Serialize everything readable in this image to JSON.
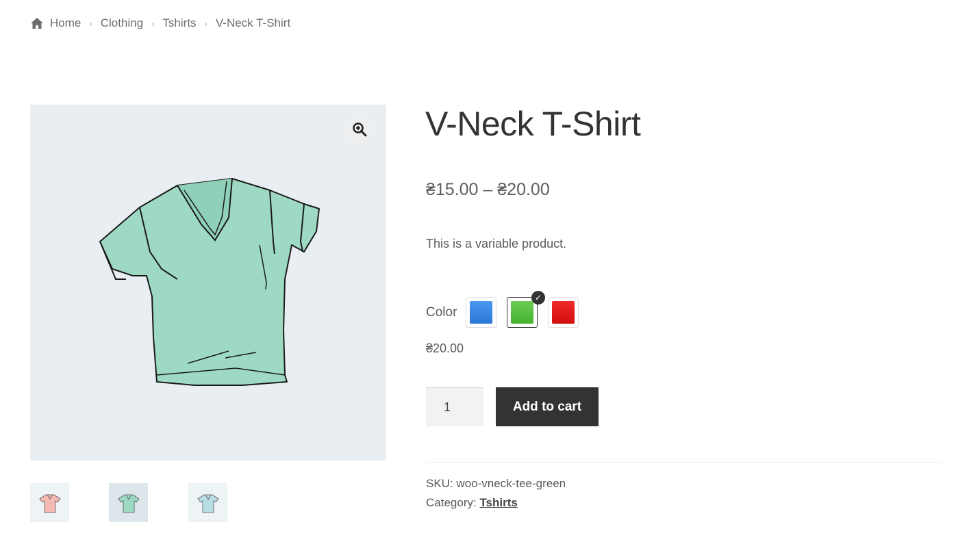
{
  "breadcrumb": {
    "home_icon": "home-icon",
    "items": [
      "Home",
      "Clothing",
      "Tshirts",
      "V-Neck T-Shirt"
    ],
    "separator_icon": "chevron-right-icon"
  },
  "gallery": {
    "zoom_icon": "zoom-in-icon",
    "main_image": "green-vneck-tshirt",
    "thumbnails": [
      {
        "name": "pink-tshirt",
        "color": "#f4b9b2"
      },
      {
        "name": "green-tshirt",
        "color": "#9ed9c3"
      },
      {
        "name": "light-blue-tshirt",
        "color": "#b9dde4"
      }
    ],
    "active_thumbnail": 1
  },
  "product": {
    "title": "V-Neck T-Shirt",
    "price_range": "₴15.00 – ₴20.00",
    "short_description": "This is a variable product.",
    "color_label": "Color",
    "swatches": [
      {
        "name": "blue",
        "color": "#2f80e0"
      },
      {
        "name": "green",
        "color": "#52bd3b"
      },
      {
        "name": "red",
        "color": "#dd1010"
      }
    ],
    "selected_swatch": "green",
    "variation_price": "₴20.00",
    "quantity": "1",
    "add_to_cart_label": "Add to cart",
    "sku_label": "SKU:",
    "sku": "woo-vneck-tee-green",
    "category_label": "Category:",
    "category": "Tshirts"
  },
  "colors": {
    "dark_button": "#333333",
    "image_bg": "#e8eef1",
    "shirt_fill": "#9ed9c3"
  }
}
